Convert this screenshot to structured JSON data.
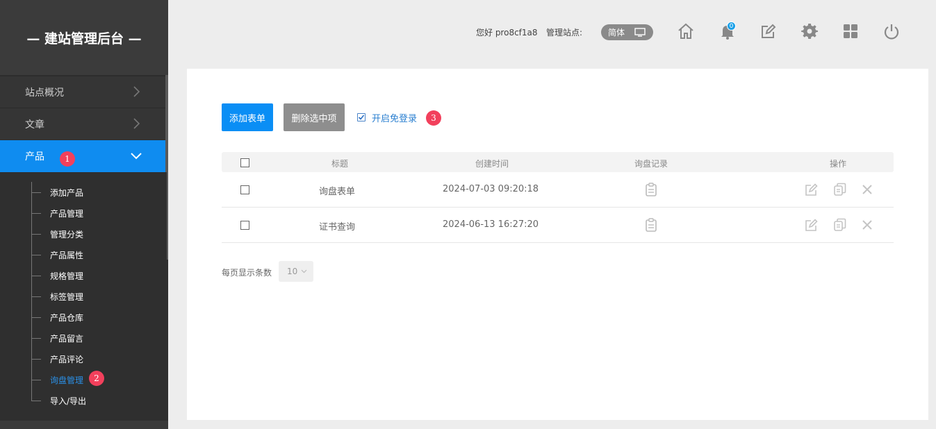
{
  "sidebar": {
    "brand": "— 建站管理后台 —",
    "menu": [
      {
        "label": "站点概况"
      },
      {
        "label": "文章"
      },
      {
        "label": "产品",
        "badge": "1"
      }
    ],
    "submenu": [
      {
        "label": "添加产品"
      },
      {
        "label": "产品管理"
      },
      {
        "label": "管理分类"
      },
      {
        "label": "产品属性"
      },
      {
        "label": "规格管理"
      },
      {
        "label": "标签管理"
      },
      {
        "label": "产品仓库"
      },
      {
        "label": "产品留言"
      },
      {
        "label": "产品评论"
      },
      {
        "label": "询盘管理",
        "badge": "2"
      },
      {
        "label": "导入/导出"
      }
    ]
  },
  "header": {
    "greeting": "您好 pro8cf1a8",
    "site_label": "管理站点:",
    "language": "简体",
    "notification_count": "0",
    "icons": [
      "home-icon",
      "bell-icon",
      "edit-icon",
      "gear-icon",
      "grid-icon",
      "power-icon"
    ]
  },
  "toolbar": {
    "add_label": "添加表单",
    "delete_label": "删除选中项",
    "login_label": "开启免登录",
    "login_badge": "3",
    "login_checked": true
  },
  "table": {
    "columns": [
      "标题",
      "创建时间",
      "询盘记录",
      "操作"
    ],
    "rows": [
      {
        "title": "询盘表单",
        "created": "2024-07-03 09:20:18"
      },
      {
        "title": "证书查询",
        "created": "2024-06-13 16:27:20"
      }
    ]
  },
  "pagination": {
    "page_size_label": "每页显示条数",
    "page_size": "10"
  },
  "colors": {
    "accent": "#0f8cf0",
    "badge": "#f2405c",
    "sidebar_bg": "#2f2f2f"
  }
}
